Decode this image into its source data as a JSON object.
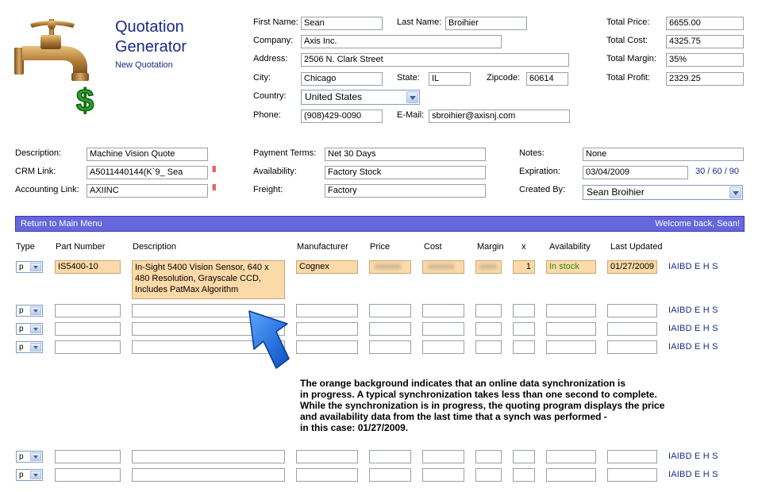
{
  "header": {
    "title_line1": "Quotation",
    "title_line2": "Generator",
    "subtitle": "New Quotation"
  },
  "customer": {
    "first_name_label": "First Name:",
    "first_name": "Sean",
    "last_name_label": "Last Name:",
    "last_name": "Broihier",
    "company_label": "Company:",
    "company": "Axis Inc.",
    "address_label": "Address:",
    "address": "2506 N. Clark Street",
    "city_label": "City:",
    "city": "Chicago",
    "state_label": "State:",
    "state": "IL",
    "zip_label": "Zipcode:",
    "zip": "60614",
    "country_label": "Country:",
    "country": "United States",
    "phone_label": "Phone:",
    "phone": "(908)429-0090",
    "email_label": "E-Mail:",
    "email": "sbroihier@axisnj.com"
  },
  "totals": {
    "price_label": "Total Price:",
    "price": "6655.00",
    "cost_label": "Total Cost:",
    "cost": "4325.75",
    "margin_label": "Total Margin:",
    "margin": "35%",
    "profit_label": "Total Profit:",
    "profit": "2329.25"
  },
  "details": {
    "description_label": "Description:",
    "description": "Machine Vision Quote",
    "crm_label": "CRM Link:",
    "crm": "A5011440144(K`9_ Sea",
    "accounting_label": "Accounting Link:",
    "accounting": "AXIINC",
    "link_mark": "‖",
    "payment_label": "Payment Terms:",
    "payment": "Net 30 Days",
    "availability_label": "Availability:",
    "availability": "Factory Stock",
    "freight_label": "Freight:",
    "freight": "Factory",
    "notes_label": "Notes:",
    "notes": "None",
    "expiration_label": "Expiration:",
    "expiration": "03/04/2009",
    "expiration_shortcuts": "30 / 60 / 90",
    "created_by_label": "Created By:",
    "created_by": "Sean Broihier"
  },
  "bar": {
    "return_label": "Return to Main Menu",
    "welcome": "Welcome back, Sean!"
  },
  "table": {
    "headers": {
      "type": "Type",
      "part": "Part Number",
      "description": "Description",
      "manufacturer": "Manufacturer",
      "price": "Price",
      "cost": "Cost",
      "margin": "Margin",
      "qty": "x",
      "availability": "Availability",
      "updated": "Last Updated"
    },
    "row1": {
      "type": "p",
      "part": "IS5400-10",
      "description": "In-Sight 5400 Vision Sensor, 640 x 480 Resolution, Grayscale CCD, Includes PatMax Algorithm",
      "manufacturer": "Cognex",
      "price": "xxxxxx",
      "cost": "xxxxxx",
      "margin": "xxxx",
      "qty": "1",
      "availability": "In stock",
      "updated": "01/27/2009"
    },
    "empty_type": "p",
    "actions": "IAIBD E H S",
    "availability_color": "#2e8b1e"
  },
  "note": {
    "line1": "The orange background indicates that an online data synchronization is",
    "line2": "in progress.  A typical synchronization takes less than one second to complete.",
    "line3": "While the synchronization is in progress, the quoting program displays the price",
    "line4": "and availability data from the last time that a synch was performed -",
    "line5": "in this case: 01/27/2009."
  },
  "colors": {
    "accent": "#1a2a8a",
    "bar": "#6666dd",
    "sync_orange": "#fcd9a8",
    "arrow": "#1f6fe0"
  }
}
